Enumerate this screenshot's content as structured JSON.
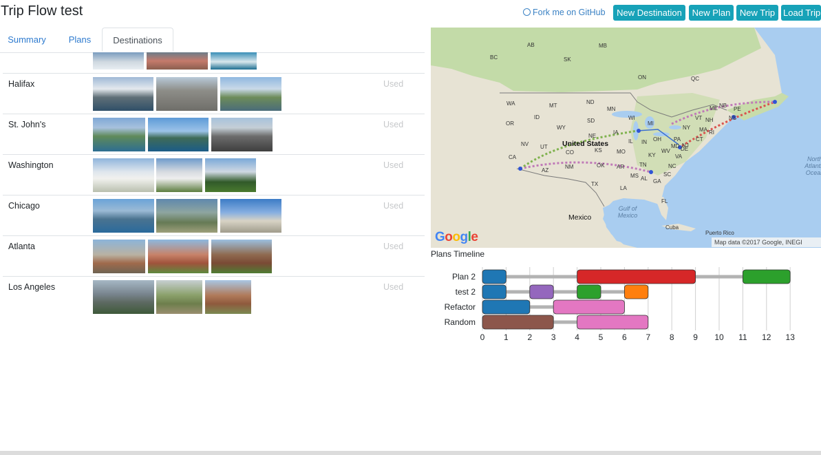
{
  "app": {
    "title": "Trip Flow test"
  },
  "header": {
    "github_link": "Fork me on GitHub",
    "buttons": [
      "New Destination",
      "New Plan",
      "New Trip",
      "Load Trip"
    ]
  },
  "tabs": [
    {
      "label": "Summary",
      "active": false
    },
    {
      "label": "Plans",
      "active": false
    },
    {
      "label": "Destinations",
      "active": true
    }
  ],
  "destinations": [
    {
      "name": "Halifax",
      "status": "Used",
      "photos": [
        "halifax-photo-1",
        "halifax-photo-2",
        "halifax-photo-3"
      ]
    },
    {
      "name": "St. John's",
      "status": "Used",
      "photos": [
        "stjohns-photo-1",
        "stjohns-photo-2",
        "stjohns-photo-3"
      ]
    },
    {
      "name": "Washington",
      "status": "Used",
      "photos": [
        "washington-photo-1",
        "washington-photo-2",
        "washington-photo-3"
      ]
    },
    {
      "name": "Chicago",
      "status": "Used",
      "photos": [
        "chicago-photo-1",
        "chicago-photo-2",
        "chicago-photo-3"
      ]
    },
    {
      "name": "Atlanta",
      "status": "Used",
      "photos": [
        "atlanta-photo-1",
        "atlanta-photo-2",
        "atlanta-photo-3"
      ]
    },
    {
      "name": "Los Angeles",
      "status": "Used",
      "photos": [
        "losangeles-photo-1",
        "losangeles-photo-2",
        "losangeles-photo-3"
      ]
    }
  ],
  "map": {
    "country_label": "United States",
    "mexico_label": "Mexico",
    "gulf_label": "Gulf of Mexico",
    "ocean_label": "North Atlantic Ocean",
    "cuba_label": "Cuba",
    "puertorico_label": "Puerto Rico",
    "attribution": "Map data ©2017 Google, INEGI",
    "logo": "Google",
    "state_labels": [
      "BC",
      "AB",
      "SK",
      "MB",
      "ON",
      "QC",
      "WA",
      "MT",
      "ND",
      "MN",
      "WI",
      "MI",
      "OR",
      "ID",
      "WY",
      "SD",
      "NE",
      "IA",
      "IL",
      "IN",
      "OH",
      "PA",
      "NY",
      "VT",
      "ME",
      "NH",
      "MA",
      "CT",
      "RI",
      "NJ",
      "MD",
      "DE",
      "WV",
      "VA",
      "KY",
      "TN",
      "NC",
      "SC",
      "GA",
      "FL",
      "AL",
      "MS",
      "LA",
      "AR",
      "MO",
      "KS",
      "OK",
      "TX",
      "NM",
      "AZ",
      "UT",
      "NV",
      "CO",
      "CA",
      "NB",
      "PE",
      "NS"
    ]
  },
  "timeline": {
    "title": "Plans Timeline",
    "rows": [
      {
        "label": "Plan 2",
        "bars": [
          {
            "start": 0,
            "end": 1,
            "color": "#1f77b4"
          },
          {
            "start": 4,
            "end": 9,
            "color": "#d62728"
          },
          {
            "start": 11,
            "end": 13,
            "color": "#2ca02c"
          }
        ]
      },
      {
        "label": "test 2",
        "bars": [
          {
            "start": 0,
            "end": 1,
            "color": "#1f77b4"
          },
          {
            "start": 2,
            "end": 3,
            "color": "#9467bd"
          },
          {
            "start": 4,
            "end": 5,
            "color": "#2ca02c"
          },
          {
            "start": 6,
            "end": 7,
            "color": "#ff7f0e"
          }
        ]
      },
      {
        "label": "Refactor",
        "bars": [
          {
            "start": 0,
            "end": 2,
            "color": "#1f77b4"
          },
          {
            "start": 3,
            "end": 6,
            "color": "#e377c2"
          }
        ]
      },
      {
        "label": "Random",
        "bars": [
          {
            "start": 0,
            "end": 3,
            "color": "#8c564b"
          },
          {
            "start": 4,
            "end": 7,
            "color": "#e377c2"
          }
        ]
      }
    ],
    "ticks": [
      0,
      1,
      2,
      3,
      4,
      5,
      6,
      7,
      8,
      9,
      10,
      11,
      12,
      13
    ]
  },
  "colors": {
    "accent": "#17a2b8",
    "link": "#2e7bcf",
    "muted": "#c6c8ca"
  }
}
